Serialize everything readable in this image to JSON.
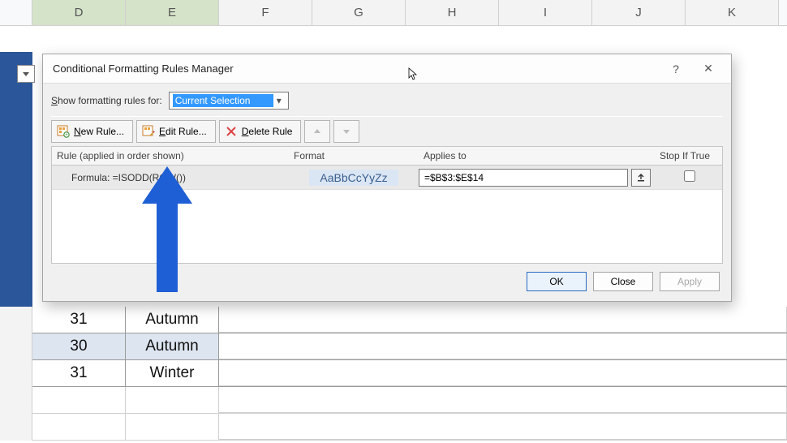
{
  "columns": [
    "D",
    "E",
    "F",
    "G",
    "H",
    "I",
    "J",
    "K"
  ],
  "dialog": {
    "title": "Conditional Formatting Rules Manager",
    "show_label": "Show formatting rules for:",
    "show_value": "Current Selection",
    "toolbar": {
      "new_label": "New Rule...",
      "edit_label": "Edit Rule...",
      "delete_label": "Delete Rule"
    },
    "headers": {
      "rule": "Rule (applied in order shown)",
      "format": "Format",
      "applies": "Applies to",
      "stop": "Stop If True"
    },
    "rules": [
      {
        "description": "Formula: =ISODD(ROW())",
        "format_preview": "AaBbCcYyZz",
        "applies_to": "=$B$3:$E$14",
        "stop_if_true": false
      }
    ],
    "buttons": {
      "ok": "OK",
      "close": "Close",
      "apply": "Apply"
    },
    "help_glyph": "?",
    "close_glyph": "✕"
  },
  "data_rows": [
    {
      "d": "31",
      "e": "Autumn",
      "shaded": false
    },
    {
      "d": "30",
      "e": "Autumn",
      "shaded": true
    },
    {
      "d": "31",
      "e": "Winter",
      "shaded": false
    }
  ]
}
